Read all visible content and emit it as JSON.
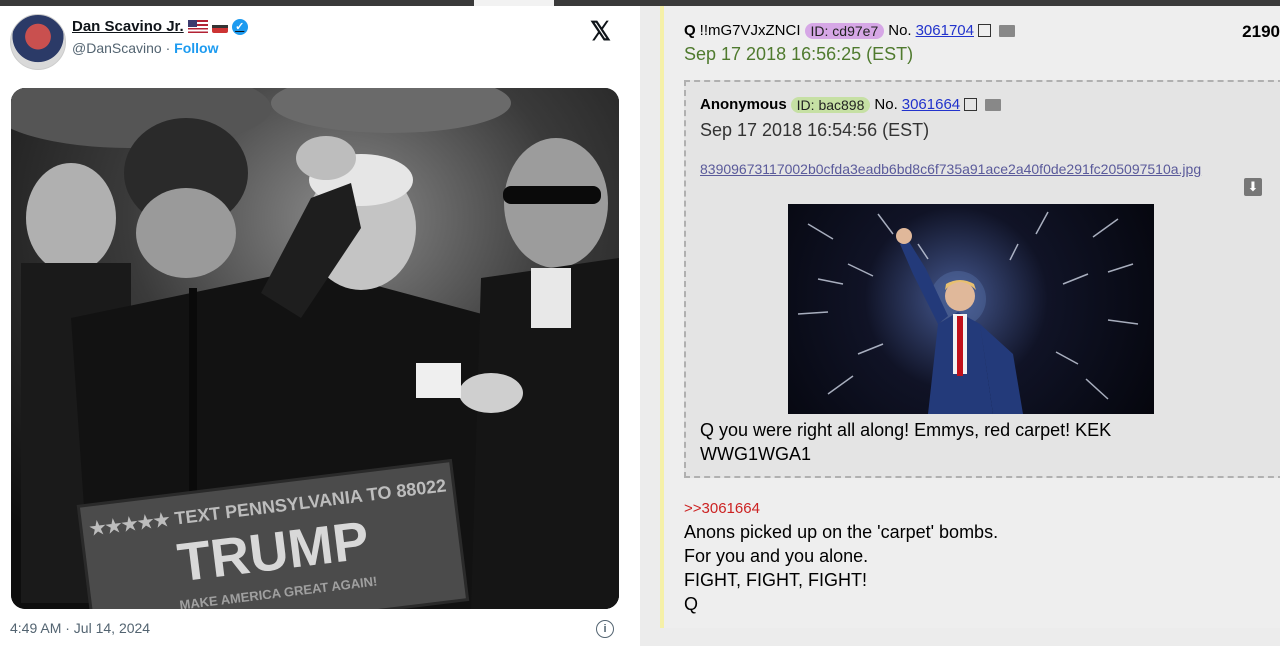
{
  "tweet": {
    "display_name": "Dan Scavino Jr.",
    "handle": "@DanScavino",
    "separator": "·",
    "follow_label": "Follow",
    "verified_glyph": "✓",
    "x_logo": "𝕏",
    "timestamp": "4:49 AM · Jul 14, 2024",
    "info_glyph": "i",
    "sign": {
      "line1": "★★★★★ TEXT PENNSYLVANIA TO 88022",
      "main": "TRUMP",
      "line3": "MAKE AMERICA GREAT AGAIN!"
    }
  },
  "post": {
    "name": "Q",
    "tripcode": "!!mG7VJxZNCI",
    "id_label": "ID: cd97e7",
    "no_prefix": "No.",
    "number": "3061704",
    "count": "2190",
    "date": "Sep 17 2018 16:56:25 (EST)",
    "quoted": {
      "name": "Anonymous",
      "id_label": "ID: bac898",
      "no_prefix": "No.",
      "number": "3061664",
      "date": "Sep 17 2018 16:54:56 (EST)",
      "filename": "83909673117002b0cfda3eadb6bd8c6f735a91ace2a40f0de291fc205097510a.jpg",
      "download_glyph": "⬇",
      "text_line1": "Q you were right all along! Emmys, red carpet! KEK",
      "text_line2": "WWG1WGA1"
    },
    "reply_ref": ">>3061664",
    "body_lines": [
      "Anons picked up on the 'carpet' bombs.",
      "For you and you alone.",
      "FIGHT, FIGHT, FIGHT!",
      "Q"
    ]
  },
  "colors": {
    "tweet_bg": "#ffffff",
    "follow_blue": "#1d9bf0",
    "post_bg": "#eeeeee",
    "date_green": "#4f7a2e",
    "id_q": "#d6a7e6",
    "id_anon": "#c6e0a4",
    "reply_red": "#cc2222",
    "link_blue": "#2233cc"
  }
}
